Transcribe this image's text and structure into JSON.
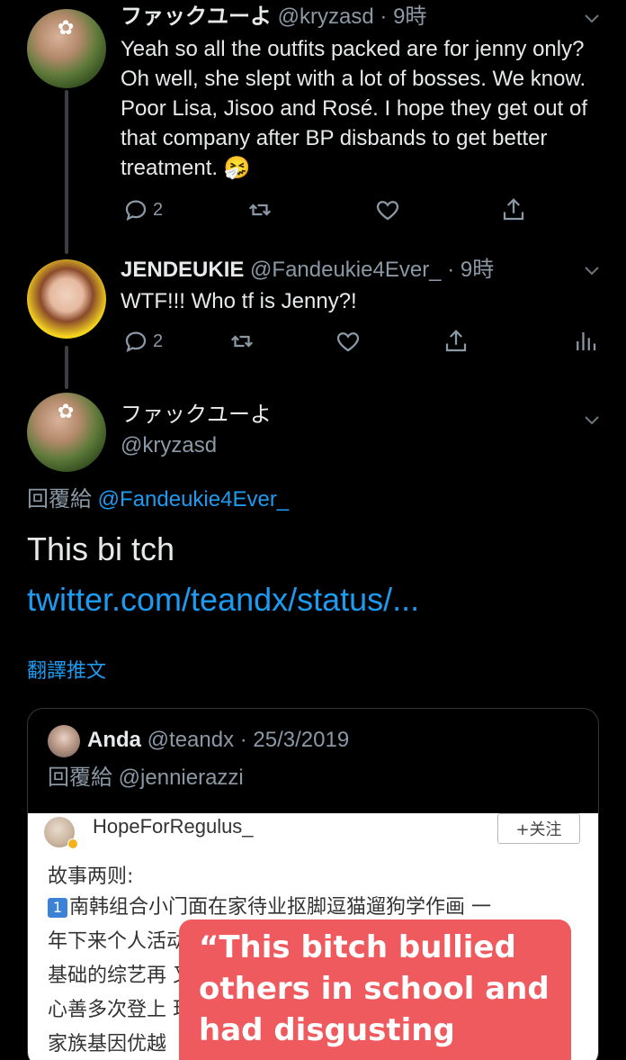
{
  "tweets": [
    {
      "display_name": "ファックユーよ",
      "handle": "@kryzasd",
      "time": "· 9時",
      "text": "Yeah so all the outfits packed are for jenny only? Oh well, she slept with a lot of bosses. We know. Poor Lisa, Jisoo and Rosé. I hope they get out of that company after BP disbands to get better treatment. 🤧",
      "reply_count": "2"
    },
    {
      "display_name": "JENDEUKIE",
      "handle": "@Fandeukie4Ever_",
      "time": "· 9時",
      "text": "WTF!!! Who tf is Jenny?!",
      "reply_count": "2"
    }
  ],
  "main": {
    "display_name": "ファックユーよ",
    "handle": "@kryzasd",
    "reply_prefix": "回覆給",
    "reply_to": "@Fandeukie4Ever_",
    "text": "This bi tch",
    "link": "twitter.com/teandx/status/...",
    "translate": "翻譯推文"
  },
  "quote": {
    "display_name": "Anda",
    "handle": "@teandx",
    "date": "· 25/3/2019",
    "reply_prefix": "回覆給",
    "reply_to": "@jennierazzi",
    "image": {
      "weibo_user": "HopeForRegulus_",
      "follow_button": "+关注",
      "lines": [
        "故事两则:",
        "南韩组合小门面在家待业抠脚逗猫遛狗学作画 一",
        "年下来个人活动频 有观众",
        "基础的综艺再 又美",
        "心善多次登上 现",
        "家族基因优越"
      ],
      "number_badge": "1",
      "caption": "“This bitch bullied others in school and had disgusting"
    }
  },
  "colors": {
    "background": "#000000",
    "text": "#e7e9ea",
    "muted": "#8b98a5",
    "link": "#1d9bf0",
    "caption_bg": "#ef5a5e"
  },
  "icons": [
    "chevron-down-icon",
    "reply-icon",
    "retweet-icon",
    "like-icon",
    "share-icon",
    "analytics-icon",
    "flower-icon"
  ]
}
